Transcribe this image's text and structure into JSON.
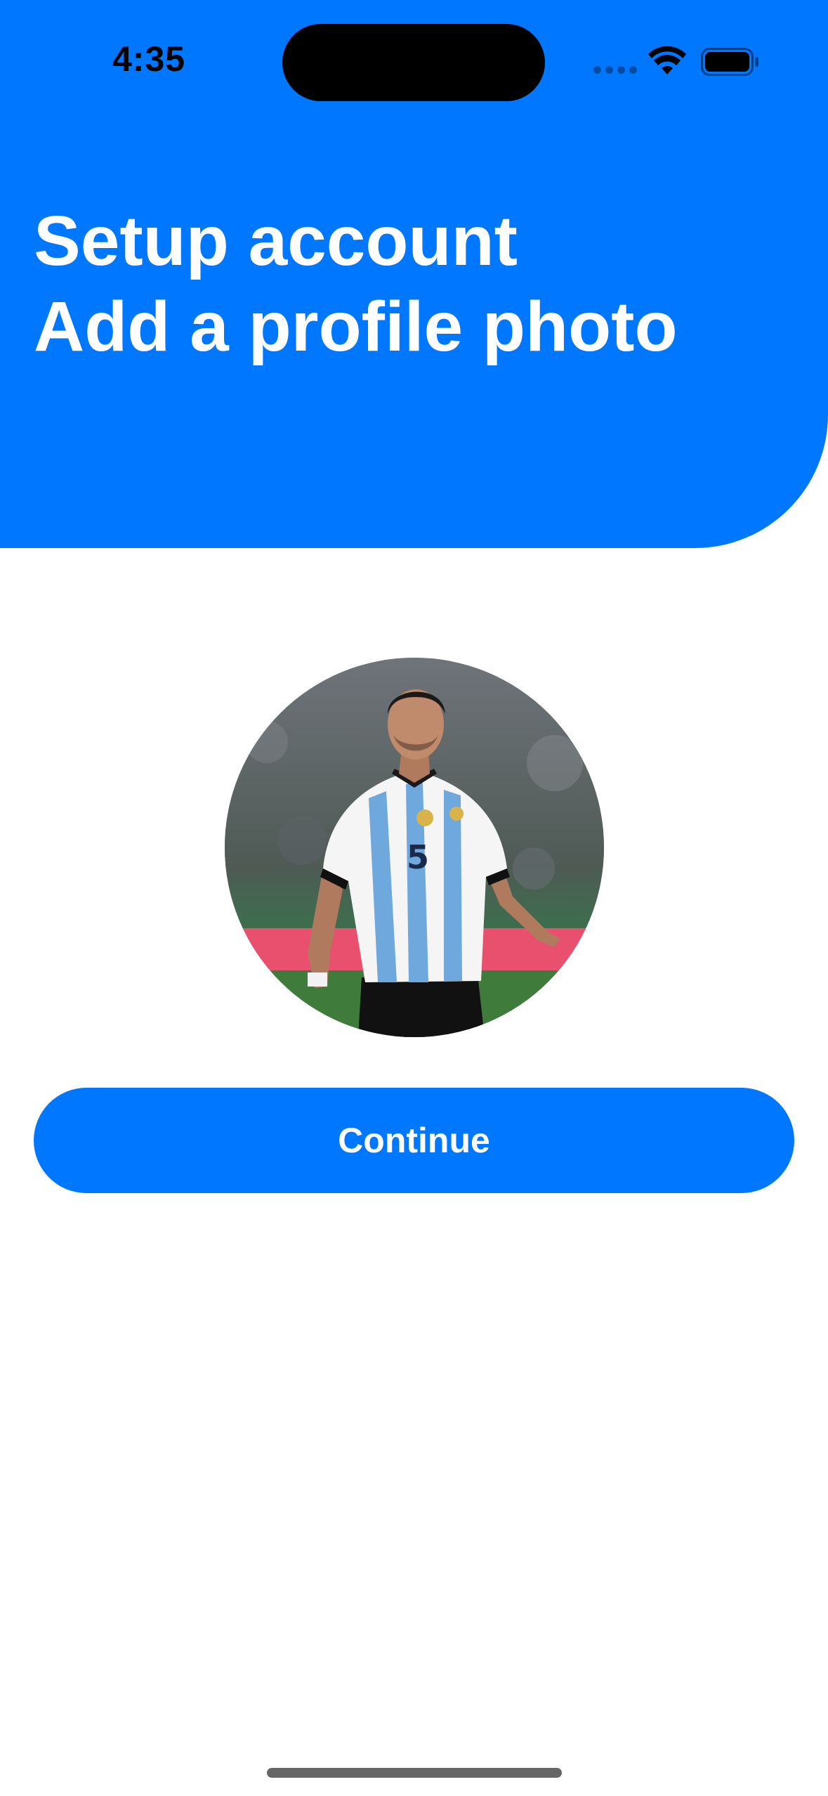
{
  "status_bar": {
    "time": "4:35",
    "icons": [
      "cellular-signal-icon",
      "wifi-icon",
      "battery-icon"
    ]
  },
  "header": {
    "title_line1": "Setup account",
    "title_line2": "Add a profile photo",
    "background_color": "#0077FF"
  },
  "profile_photo": {
    "alt": "Profile photo",
    "shape": "circle"
  },
  "actions": {
    "continue_label": "Continue"
  },
  "colors": {
    "accent": "#0077FF",
    "text_on_accent": "#FFFFFF",
    "background": "#FFFFFF"
  }
}
